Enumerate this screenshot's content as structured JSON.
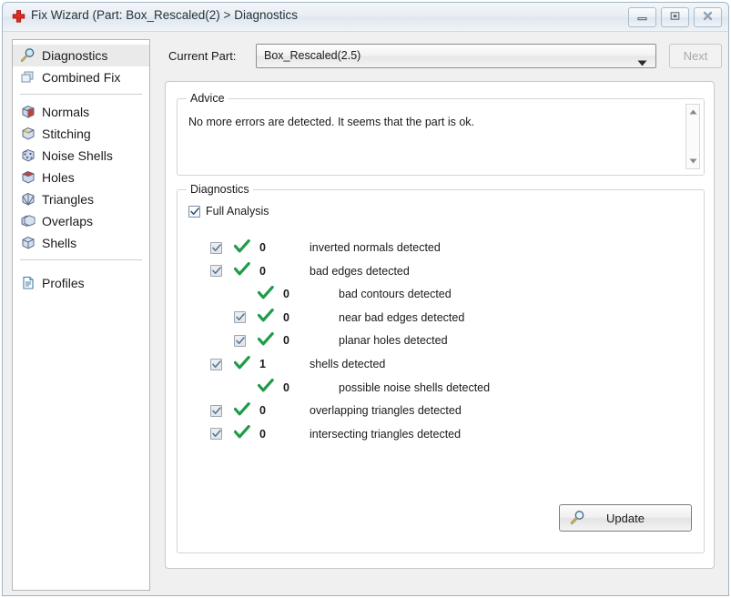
{
  "window": {
    "title": "Fix Wizard (Part: Box_Rescaled(2) > Diagnostics",
    "icon": "red-cross-icon",
    "controls": {
      "minimize": "minimize-icon",
      "maximize": "maximize-icon",
      "close": "close-icon"
    }
  },
  "sidebar": {
    "groups": [
      {
        "items": [
          {
            "label": "Diagnostics",
            "icon": "magnifier-icon",
            "selected": true
          },
          {
            "label": "Combined Fix",
            "icon": "stacked-boxes-icon",
            "selected": false
          }
        ]
      },
      {
        "items": [
          {
            "label": "Normals",
            "icon": "cube-red-face-icon",
            "selected": false
          },
          {
            "label": "Stitching",
            "icon": "cube-yellow-seam-icon",
            "selected": false
          },
          {
            "label": "Noise Shells",
            "icon": "cube-speckled-icon",
            "selected": false
          },
          {
            "label": "Holes",
            "icon": "cube-hole-icon",
            "selected": false
          },
          {
            "label": "Triangles",
            "icon": "cube-triangles-icon",
            "selected": false
          },
          {
            "label": "Overlaps",
            "icon": "cube-overlap-icon",
            "selected": false
          },
          {
            "label": "Shells",
            "icon": "cube-plain-icon",
            "selected": false
          }
        ]
      },
      {
        "items": [
          {
            "label": "Profiles",
            "icon": "document-icon",
            "selected": false
          }
        ]
      }
    ]
  },
  "toolbar": {
    "current_part_label": "Current Part:",
    "current_part_value": "Box_Rescaled(2.5)",
    "dropdown_icon": "chevron-down-icon",
    "next_label": "Next",
    "next_enabled": false
  },
  "advice": {
    "title": "Advice",
    "text": "No more errors are detected. It seems that the part is ok.",
    "scroll_up_icon": "triangle-up-icon",
    "scroll_down_icon": "triangle-down-icon"
  },
  "diagnostics": {
    "title": "Diagnostics",
    "full_analysis_label": "Full Analysis",
    "full_analysis_checked": true,
    "check_icon": "green-check-icon",
    "rows": [
      {
        "indent": 0,
        "checkbox": true,
        "checked": true,
        "disabled": true,
        "count": "0",
        "label": "inverted normals detected"
      },
      {
        "indent": 0,
        "checkbox": true,
        "checked": true,
        "disabled": true,
        "count": "0",
        "label": "bad edges detected"
      },
      {
        "indent": 1,
        "checkbox": false,
        "checked": false,
        "disabled": true,
        "count": "0",
        "label": "bad contours detected"
      },
      {
        "indent": 1,
        "checkbox": true,
        "checked": true,
        "disabled": true,
        "count": "0",
        "label": "near bad edges detected"
      },
      {
        "indent": 1,
        "checkbox": true,
        "checked": true,
        "disabled": true,
        "count": "0",
        "label": "planar holes detected"
      },
      {
        "indent": 0,
        "checkbox": true,
        "checked": true,
        "disabled": true,
        "count": "1",
        "label": "shells detected"
      },
      {
        "indent": 1,
        "checkbox": false,
        "checked": false,
        "disabled": true,
        "count": "0",
        "label": "possible noise shells detected"
      },
      {
        "indent": 0,
        "checkbox": true,
        "checked": true,
        "disabled": true,
        "count": "0",
        "label": "overlapping triangles detected"
      },
      {
        "indent": 0,
        "checkbox": true,
        "checked": true,
        "disabled": true,
        "count": "0",
        "label": "intersecting triangles detected"
      }
    ],
    "update_label": "Update",
    "update_icon": "magnifier-icon"
  },
  "colors": {
    "check_green": "#1f9b4a",
    "accent_red": "#e02b20",
    "titlebar": "#e8eef4",
    "background": "#f0f0f0"
  }
}
